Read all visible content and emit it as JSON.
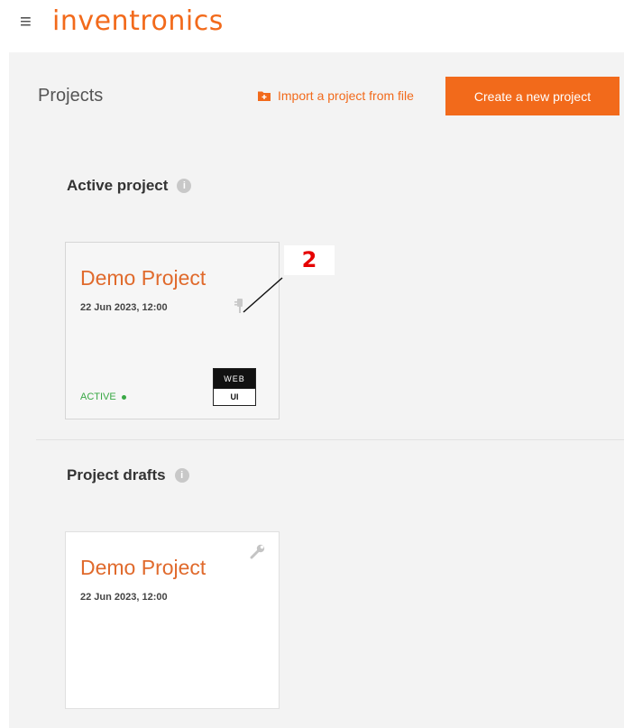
{
  "header": {
    "menu_icon": "≡",
    "logo_text": "inventronics"
  },
  "toolbar": {
    "page_title": "Projects",
    "import_label": "Import a project from file",
    "create_label": "Create a new project"
  },
  "active_section": {
    "title": "Active project",
    "info_icon": "i",
    "card": {
      "name": "Demo Project",
      "date": "22 Jun 2023, 12:00",
      "status": "ACTIVE",
      "badge_top": "WEB",
      "badge_bottom": "UI"
    }
  },
  "drafts_section": {
    "title": "Project drafts",
    "info_icon": "i",
    "card": {
      "name": "Demo Project",
      "date": "22 Jun 2023, 12:00"
    }
  },
  "annotation": {
    "label": "2"
  },
  "colors": {
    "accent": "#f26a1b",
    "active_status": "#39a845",
    "annotation": "#e60000"
  },
  "icons": [
    "hamburger-menu-icon",
    "folder-plus-icon",
    "info-icon",
    "plug-icon",
    "wrench-icon"
  ]
}
